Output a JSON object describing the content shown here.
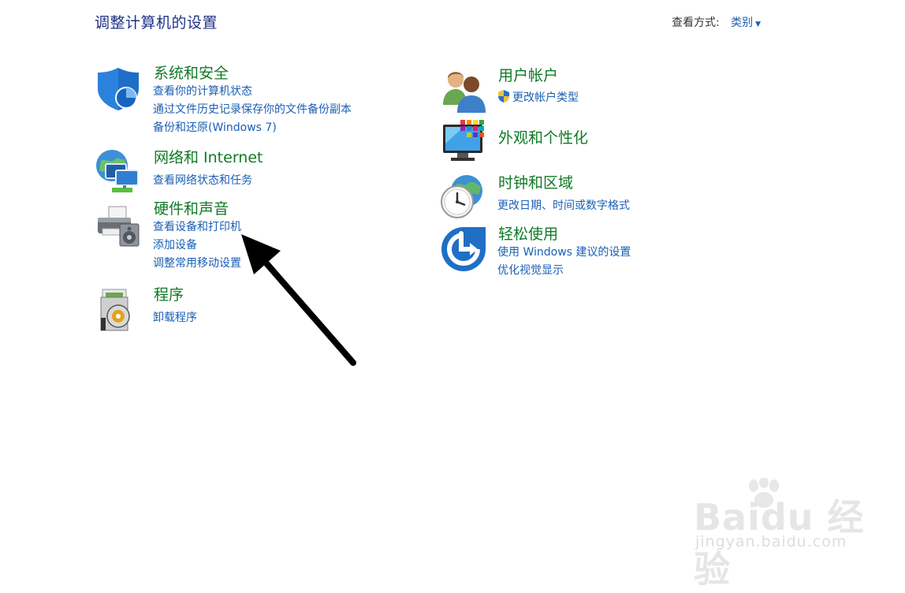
{
  "header": {
    "title": "调整计算机的设置",
    "view_by_label": "查看方式:",
    "view_by_value": "类别"
  },
  "categories": [
    {
      "id": "system-security",
      "title": "系统和安全",
      "icon": "shield-icon",
      "links": [
        "查看你的计算机状态",
        "通过文件历史记录保存你的文件备份副本",
        "备份和还原(Windows 7)"
      ]
    },
    {
      "id": "network-internet",
      "title": "网络和 Internet",
      "icon": "network-globe-icon",
      "links": [
        "查看网络状态和任务"
      ]
    },
    {
      "id": "hardware-sound",
      "title": "硬件和声音",
      "icon": "printer-icon",
      "links": [
        "查看设备和打印机",
        "添加设备",
        "调整常用移动设置"
      ]
    },
    {
      "id": "programs",
      "title": "程序",
      "icon": "programs-disc-icon",
      "links": [
        "卸载程序"
      ]
    },
    {
      "id": "user-accounts",
      "title": "用户帐户",
      "icon": "users-icon",
      "links": [
        "更改帐户类型"
      ]
    },
    {
      "id": "appearance",
      "title": "外观和个性化",
      "icon": "monitor-colors-icon",
      "links": []
    },
    {
      "id": "clock-region",
      "title": "时钟和区域",
      "icon": "clock-globe-icon",
      "links": [
        "更改日期、时间或数字格式"
      ]
    },
    {
      "id": "ease-access",
      "title": "轻松使用",
      "icon": "ease-of-access-icon",
      "links": [
        "使用 Windows 建议的设置",
        "优化视觉显示"
      ]
    }
  ],
  "watermark": {
    "brand": "Baidu 经验",
    "url": "jingyan.baidu.com"
  },
  "colors": {
    "title": "#1e3287",
    "category": "#0f7a26",
    "link": "#1a5fb4"
  }
}
